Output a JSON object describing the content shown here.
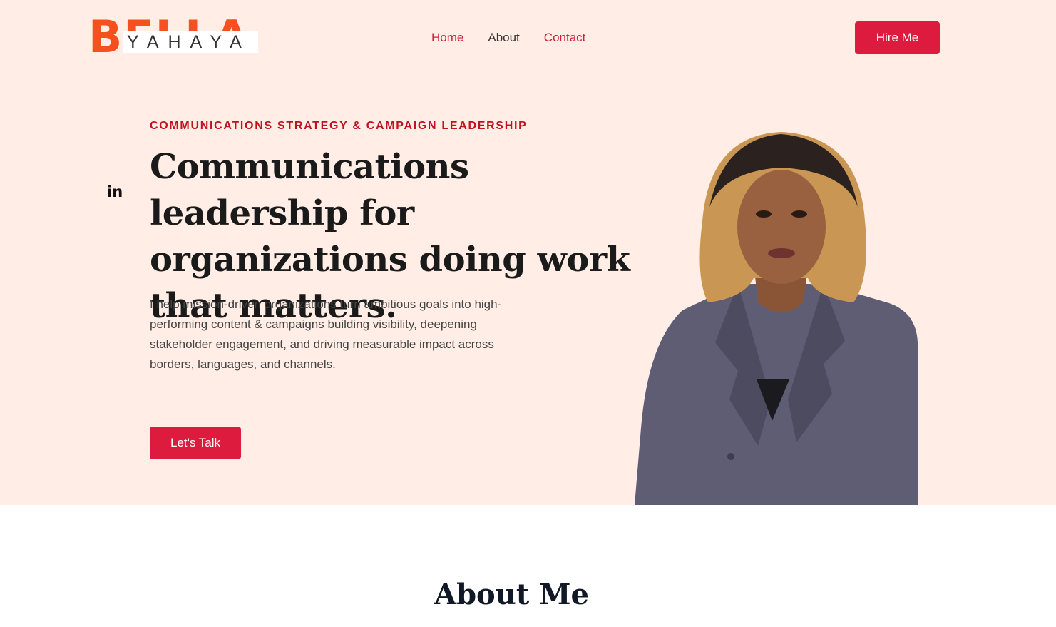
{
  "logo": {
    "big_text": "BELLA",
    "small_text": "YAHAYA"
  },
  "nav": {
    "home": "Home",
    "about": "About",
    "contact": "Contact"
  },
  "header": {
    "hire_button": "Hire Me"
  },
  "social": {
    "linkedin": "in"
  },
  "hero": {
    "eyebrow": "COMMUNICATIONS STRATEGY & CAMPAIGN LEADERSHIP",
    "headline": "Communications leadership for organizations doing work that matters.",
    "description": "I help mission-driven organizations turn ambitious goals into high-performing content & campaigns building visibility, deepening stakeholder engagement, and driving measurable impact across borders, languages, and channels.",
    "cta": "Let's Talk"
  },
  "about": {
    "title": "About Me"
  },
  "colors": {
    "hero_bg": "#ffede6",
    "accent": "#dc1b3e",
    "logo_orange": "#f4511e",
    "eyebrow": "#c0121f"
  }
}
